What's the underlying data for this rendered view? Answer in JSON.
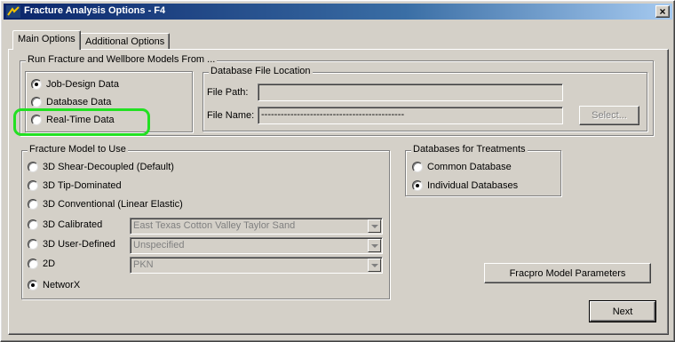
{
  "window": {
    "title": "Fracture Analysis Options - F4",
    "close_label": "×"
  },
  "tabs": [
    {
      "label": "Main Options",
      "active": true
    },
    {
      "label": "Additional Options",
      "active": false
    }
  ],
  "run_models": {
    "legend": "Run Fracture and Wellbore Models From ...",
    "options": [
      {
        "label": "Job-Design Data",
        "checked": true
      },
      {
        "label": "Database Data",
        "checked": false
      },
      {
        "label": "Real-Time Data",
        "checked": false
      }
    ]
  },
  "database_file": {
    "legend": "Database File Location",
    "file_path_label": "File Path:",
    "file_path_value": "",
    "file_name_label": "File Name:",
    "file_name_value": "--------------------------------------------",
    "select_button": "Select..."
  },
  "fracture_model": {
    "legend": "Fracture Model to Use",
    "options": [
      {
        "label": "3D Shear-Decoupled (Default)",
        "checked": false
      },
      {
        "label": "3D Tip-Dominated",
        "checked": false
      },
      {
        "label": "3D Conventional (Linear Elastic)",
        "checked": false
      },
      {
        "label": "3D Calibrated",
        "checked": false,
        "select": "East Texas Cotton Valley Taylor Sand"
      },
      {
        "label": "3D User-Defined",
        "checked": false,
        "select": "Unspecified"
      },
      {
        "label": "2D",
        "checked": false,
        "select": "PKN"
      },
      {
        "label": "NetworX",
        "checked": true
      }
    ]
  },
  "databases_treatments": {
    "legend": "Databases for Treatments",
    "options": [
      {
        "label": "Common Database",
        "checked": false
      },
      {
        "label": "Individual Databases",
        "checked": true
      }
    ]
  },
  "buttons": {
    "fracpro_params": "Fracpro Model Parameters",
    "next": "Next"
  },
  "colors": {
    "highlight": "#22e022",
    "title_bar": "#0a246a"
  }
}
